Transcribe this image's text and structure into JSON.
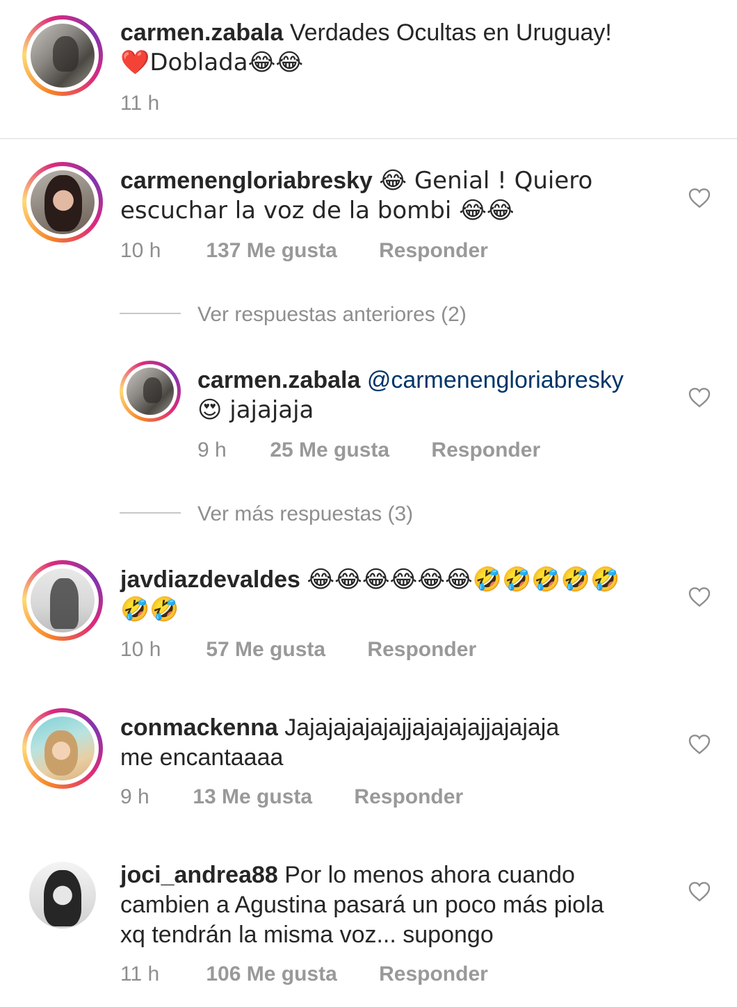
{
  "caption": {
    "username": "carmen.zabala",
    "text_line1": "Verdades Ocultas en Uruguay!",
    "text_line2": "❤️Doblada😂😂",
    "time": "11 h"
  },
  "comments": [
    {
      "username": "carmenengloriabresky",
      "text_line1": "😂 Genial ! Quiero",
      "text_line2": "escuchar la voz de la bombi 😂😂",
      "time": "10 h",
      "likes": "137 Me gusta",
      "reply": "Responder"
    },
    {
      "username": "javdiazdevaldes",
      "text_line1": "😂😂😂😂😂😂🤣🤣🤣🤣🤣",
      "text_line2": "🤣🤣",
      "time": "10 h",
      "likes": "57 Me gusta",
      "reply": "Responder"
    },
    {
      "username": "conmackenna",
      "text_line1": "Jajajajajajajjajajajajjajajaja",
      "text_line2": "me encantaaaa",
      "time": "9 h",
      "likes": "13 Me gusta",
      "reply": "Responder"
    },
    {
      "username": "joci_andrea88",
      "text_line1": "Por lo menos ahora cuando",
      "text_line2": "cambien a Agustina pasará un poco más piola",
      "text_line3": "xq tendrán la misma voz... supongo",
      "time": "11 h",
      "likes": "106 Me gusta",
      "reply": "Responder"
    }
  ],
  "thread": {
    "view_previous": "Ver respuestas anteriores (2)",
    "view_more": "Ver más respuestas (3)",
    "reply": {
      "username": "carmen.zabala",
      "mention": "@carmenengloriabresky",
      "text_line2": "😍 jajajaja",
      "time": "9 h",
      "likes": "25 Me gusta",
      "reply_label": "Responder"
    }
  },
  "icons": {
    "like": "heart-outline-icon"
  },
  "colors": {
    "mention": "#003569",
    "meta": "#8e8e8e",
    "text": "#262626"
  }
}
